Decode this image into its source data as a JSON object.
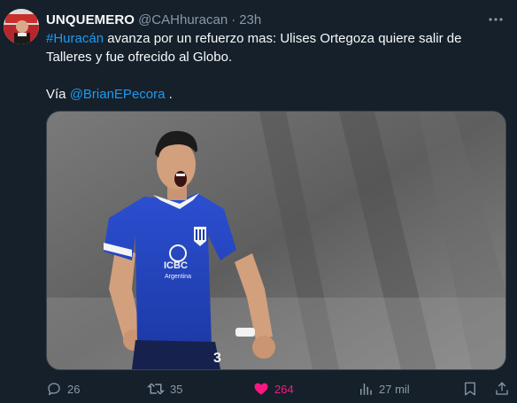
{
  "tweet": {
    "author_name": "UNQUEMERO",
    "author_handle": "@CAHhuracan",
    "separator": "·",
    "time": "23h",
    "text_hashtag": "#Huracán",
    "text_line1_rest": " avanza por un refuerzo mas: Ulises Ortegoza quiere salir de Talleres y fue ofrecido al Globo.",
    "via_prefix": "Vía ",
    "via_mention": "@BrianEPecora",
    "via_suffix": " ."
  },
  "media": {
    "jersey_brand": "ICBC",
    "jersey_sub": "Argentina",
    "jersey_number": "3"
  },
  "actions": {
    "replies": "26",
    "reposts": "35",
    "likes": "264",
    "views": "27 mil"
  },
  "colors": {
    "background": "#15202b",
    "accent": "#1d9bf0",
    "like": "#f91880",
    "muted": "#8b98a5"
  },
  "icons": [
    "more-icon",
    "reply-icon",
    "repost-icon",
    "like-icon",
    "views-icon",
    "bookmark-icon",
    "share-icon"
  ]
}
